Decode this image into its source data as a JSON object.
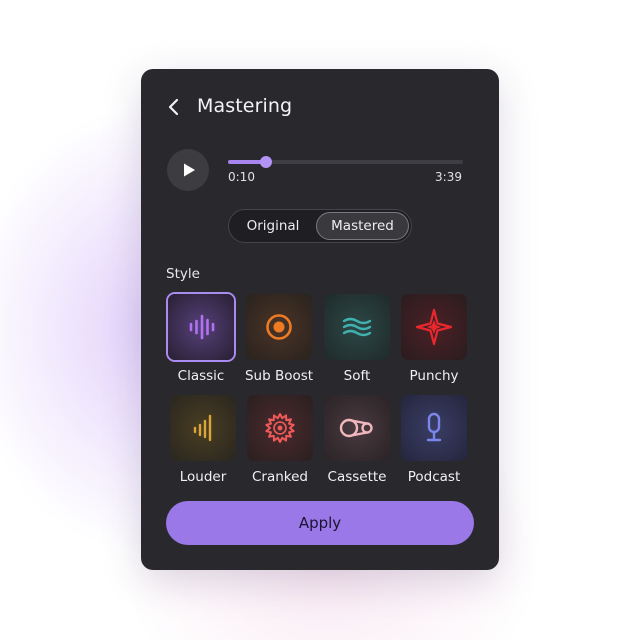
{
  "header": {
    "title": "Mastering",
    "back_icon": "chevron-left-icon"
  },
  "player": {
    "play_icon": "play-icon",
    "current_time": "0:10",
    "total_time": "3:39",
    "progress": 0.16
  },
  "toggle": {
    "original_label": "Original",
    "mastered_label": "Mastered",
    "selected": "Mastered"
  },
  "style": {
    "label": "Style",
    "selected": "Classic",
    "items": [
      {
        "label": "Classic",
        "icon": "waveform-icon",
        "color": "#b072f0",
        "bg": "#3a2b4c"
      },
      {
        "label": "Sub Boost",
        "icon": "speaker-target-icon",
        "color": "#ee7a24",
        "bg": "#3a2a22"
      },
      {
        "label": "Soft",
        "icon": "soft-waves-icon",
        "color": "#3fb2b0",
        "bg": "#223836"
      },
      {
        "label": "Punchy",
        "icon": "star-burst-icon",
        "color": "#e8282e",
        "bg": "#3b1d21"
      },
      {
        "label": "Louder",
        "icon": "rising-bars-icon",
        "color": "#d9a63a",
        "bg": "#3a3220"
      },
      {
        "label": "Cranked",
        "icon": "gear-burst-icon",
        "color": "#ef5a5a",
        "bg": "#3b2224"
      },
      {
        "label": "Cassette",
        "icon": "cassette-reels-icon",
        "color": "#f0b8bd",
        "bg": "#3b2b30"
      },
      {
        "label": "Podcast",
        "icon": "microphone-icon",
        "color": "#7b86ea",
        "bg": "#2b2d49"
      }
    ]
  },
  "apply": {
    "label": "Apply"
  }
}
